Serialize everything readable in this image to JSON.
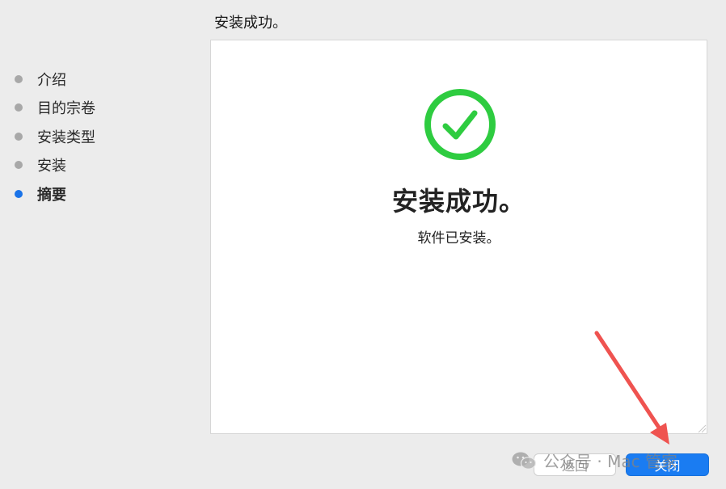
{
  "header": {
    "title": "安装成功。"
  },
  "sidebar": {
    "items": [
      {
        "label": "介绍",
        "active": false
      },
      {
        "label": "目的宗卷",
        "active": false
      },
      {
        "label": "安装类型",
        "active": false
      },
      {
        "label": "安装",
        "active": false
      },
      {
        "label": "摘要",
        "active": true
      }
    ]
  },
  "main": {
    "icon": "check-circle-icon",
    "title": "安装成功。",
    "subtitle": "软件已安装。"
  },
  "buttons": {
    "back_label": "返回",
    "close_label": "关闭"
  },
  "watermark": {
    "text": "公众号 · Mac 管家"
  },
  "colors": {
    "accent": "#1a7cf2",
    "success": "#2ecc40",
    "active_dot": "#1a73e8",
    "inactive_dot": "#a8a8a8",
    "annotation_arrow": "#ef5350"
  }
}
